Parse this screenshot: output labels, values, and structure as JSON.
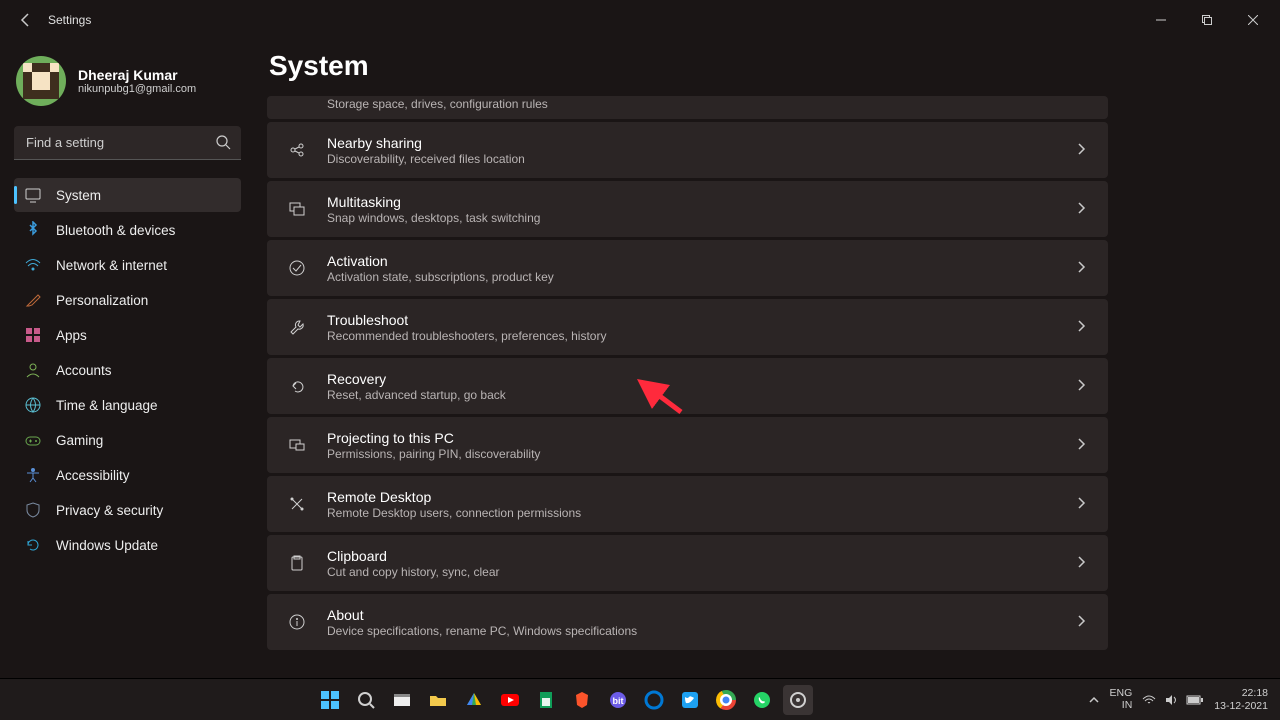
{
  "window": {
    "title": "Settings"
  },
  "user": {
    "name": "Dheeraj Kumar",
    "email": "nikunpubg1@gmail.com"
  },
  "search": {
    "placeholder": "Find a setting"
  },
  "page": {
    "heading": "System"
  },
  "sidebar": {
    "items": [
      {
        "key": "system",
        "label": "System",
        "icon": "monitor",
        "selected": true
      },
      {
        "key": "bluetooth",
        "label": "Bluetooth & devices",
        "icon": "bluetooth",
        "color": "#3a9bdc"
      },
      {
        "key": "network",
        "label": "Network & internet",
        "icon": "wifi",
        "color": "#3fa9d6"
      },
      {
        "key": "personalization",
        "label": "Personalization",
        "icon": "brush",
        "color": "#c06a3a"
      },
      {
        "key": "apps",
        "label": "Apps",
        "icon": "grid",
        "color": "#c85a8a"
      },
      {
        "key": "accounts",
        "label": "Accounts",
        "icon": "person",
        "color": "#7eb357"
      },
      {
        "key": "time",
        "label": "Time & language",
        "icon": "globe",
        "color": "#5abed1"
      },
      {
        "key": "gaming",
        "label": "Gaming",
        "icon": "gamepad",
        "color": "#6aa84f"
      },
      {
        "key": "accessibility",
        "label": "Accessibility",
        "icon": "accessibility",
        "color": "#5a8fd6"
      },
      {
        "key": "privacy",
        "label": "Privacy & security",
        "icon": "shield",
        "color": "#7a8aa0"
      },
      {
        "key": "update",
        "label": "Windows Update",
        "icon": "update",
        "color": "#2fa8d8"
      }
    ]
  },
  "cards": [
    {
      "key": "storage_partial",
      "title": "",
      "sub": "Storage space, drives, configuration rules",
      "icon": "",
      "partial": true
    },
    {
      "key": "nearby",
      "title": "Nearby sharing",
      "sub": "Discoverability, received files location",
      "icon": "share"
    },
    {
      "key": "multitask",
      "title": "Multitasking",
      "sub": "Snap windows, desktops, task switching",
      "icon": "windows"
    },
    {
      "key": "activation",
      "title": "Activation",
      "sub": "Activation state, subscriptions, product key",
      "icon": "check-circle"
    },
    {
      "key": "troubleshoot",
      "title": "Troubleshoot",
      "sub": "Recommended troubleshooters, preferences, history",
      "icon": "wrench"
    },
    {
      "key": "recovery",
      "title": "Recovery",
      "sub": "Reset, advanced startup, go back",
      "icon": "undo"
    },
    {
      "key": "projecting",
      "title": "Projecting to this PC",
      "sub": "Permissions, pairing PIN, discoverability",
      "icon": "project"
    },
    {
      "key": "remote",
      "title": "Remote Desktop",
      "sub": "Remote Desktop users, connection permissions",
      "icon": "remote"
    },
    {
      "key": "clipboard",
      "title": "Clipboard",
      "sub": "Cut and copy history, sync, clear",
      "icon": "clipboard"
    },
    {
      "key": "about",
      "title": "About",
      "sub": "Device specifications, rename PC, Windows specifications",
      "icon": "info"
    }
  ],
  "taskbar": {
    "apps": [
      {
        "name": "start",
        "color": "#4cc2ff"
      },
      {
        "name": "search",
        "color": "#d0d0d0"
      },
      {
        "name": "taskview",
        "color": "#d0d0d0"
      },
      {
        "name": "explorer",
        "color": "#f2c94c"
      },
      {
        "name": "drive",
        "color": "#34a853"
      },
      {
        "name": "youtube",
        "color": "#ff0000"
      },
      {
        "name": "sheets",
        "color": "#0f9d58"
      },
      {
        "name": "brave",
        "color": "#fb542b"
      },
      {
        "name": "bit",
        "color": "#6c5ce7"
      },
      {
        "name": "edge",
        "color": "#0078d4"
      },
      {
        "name": "twitter",
        "color": "#1da1f2"
      },
      {
        "name": "chrome",
        "color": "#ea4335"
      },
      {
        "name": "whatsapp",
        "color": "#25d366"
      },
      {
        "name": "settings",
        "color": "#9aa0a6",
        "active": true
      }
    ],
    "tray": {
      "chev": "up"
    },
    "lang": {
      "line1": "ENG",
      "line2": "IN"
    },
    "clock": {
      "time": "22:18",
      "date": "13-12-2021"
    }
  }
}
